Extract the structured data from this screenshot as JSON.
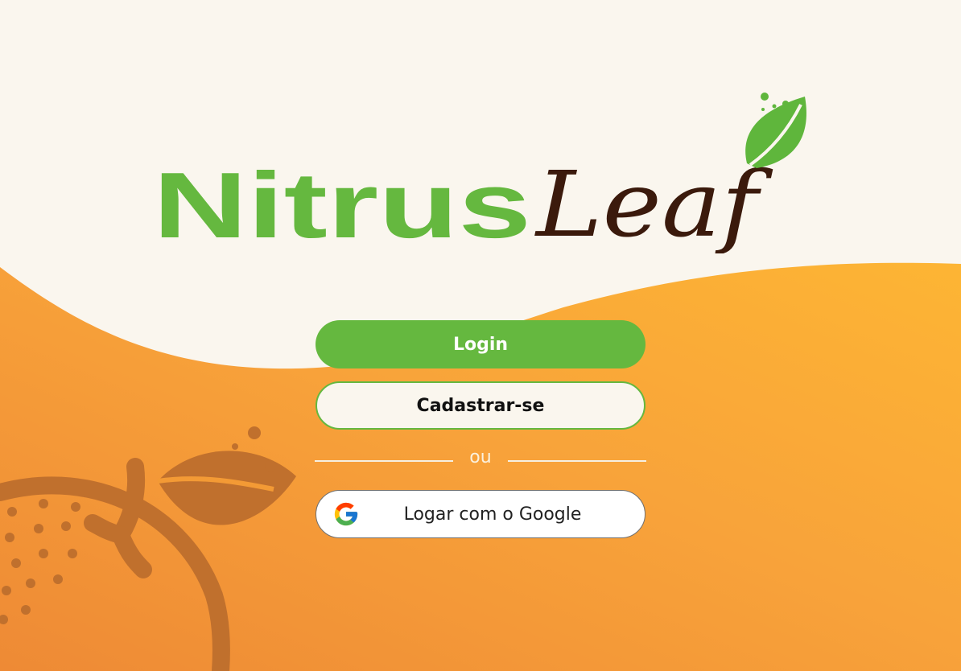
{
  "app": {
    "name_part1": "Nitrus",
    "name_part2": "Leaf"
  },
  "colors": {
    "brand_green": "#65b83f",
    "dark_brown": "#3b1a0c",
    "orange": "#f39a35",
    "cream": "#faf6ee"
  },
  "buttons": {
    "login_label": "Login",
    "signup_label": "Cadastrar-se",
    "google_label": "Logar com o Google",
    "google_icon": "google-g-icon"
  },
  "separator": {
    "label": "ou"
  }
}
